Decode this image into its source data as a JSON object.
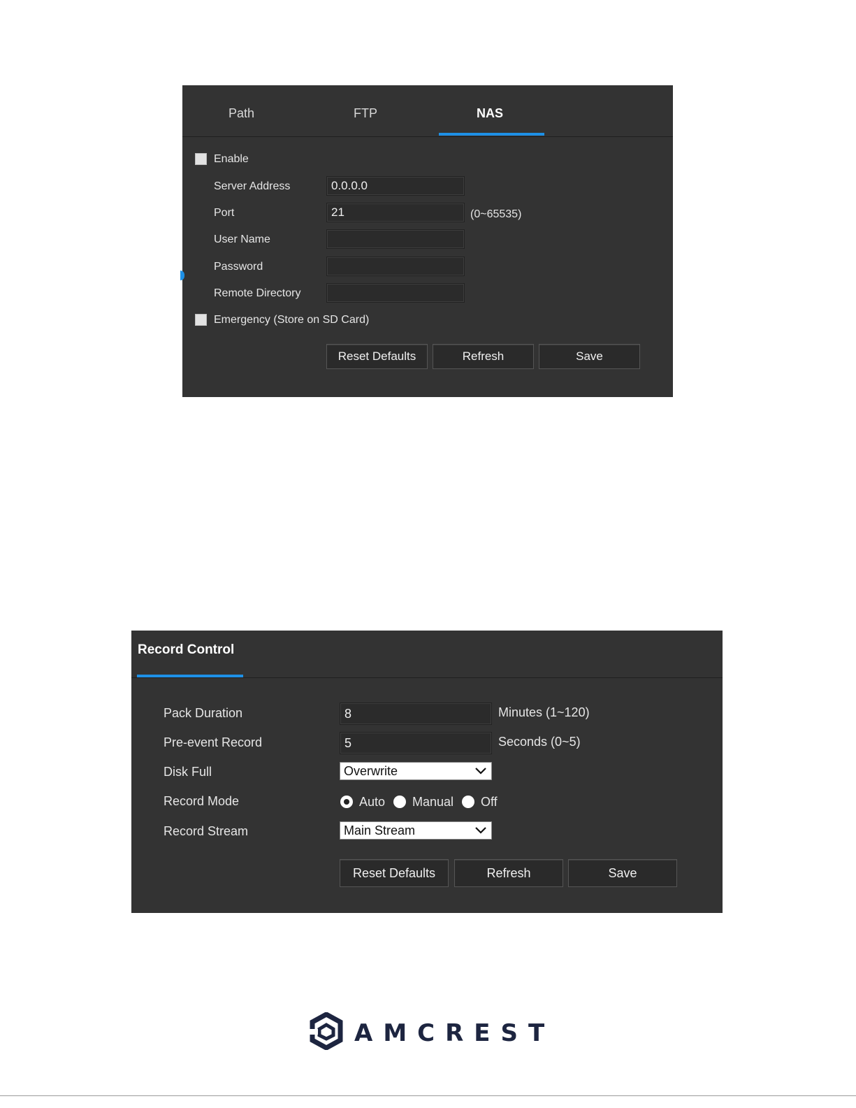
{
  "nas": {
    "tabs": [
      "Path",
      "FTP",
      "NAS"
    ],
    "active_tab": "NAS",
    "enable_label": "Enable",
    "enable_checked": false,
    "server_address_label": "Server Address",
    "server_address_value": "0.0.0.0",
    "port_label": "Port",
    "port_value": "21",
    "port_range": "(0~65535)",
    "user_name_label": "User Name",
    "user_name_value": "",
    "password_label": "Password",
    "password_value": "",
    "remote_directory_label": "Remote Directory",
    "remote_directory_value": "",
    "emergency_label": "Emergency (Store on SD Card)",
    "emergency_checked": false,
    "buttons": {
      "reset": "Reset Defaults",
      "refresh": "Refresh",
      "save": "Save"
    }
  },
  "record_control": {
    "title": "Record Control",
    "pack_duration_label": "Pack Duration",
    "pack_duration_value": "8",
    "pack_duration_unit": "Minutes  (1~120)",
    "pre_event_label": "Pre-event Record",
    "pre_event_value": "5",
    "pre_event_unit": "Seconds  (0~5)",
    "disk_full_label": "Disk Full",
    "disk_full_value": "Overwrite",
    "record_mode_label": "Record Mode",
    "record_mode_options": [
      "Auto",
      "Manual",
      "Off"
    ],
    "record_mode_selected": "Auto",
    "record_stream_label": "Record Stream",
    "record_stream_value": "Main Stream",
    "buttons": {
      "reset": "Reset Defaults",
      "refresh": "Refresh",
      "save": "Save"
    }
  },
  "logo": {
    "text": "AMCREST",
    "color": "#1d2540"
  },
  "colors": {
    "panel": "#333333",
    "accent": "#1e90e6"
  }
}
